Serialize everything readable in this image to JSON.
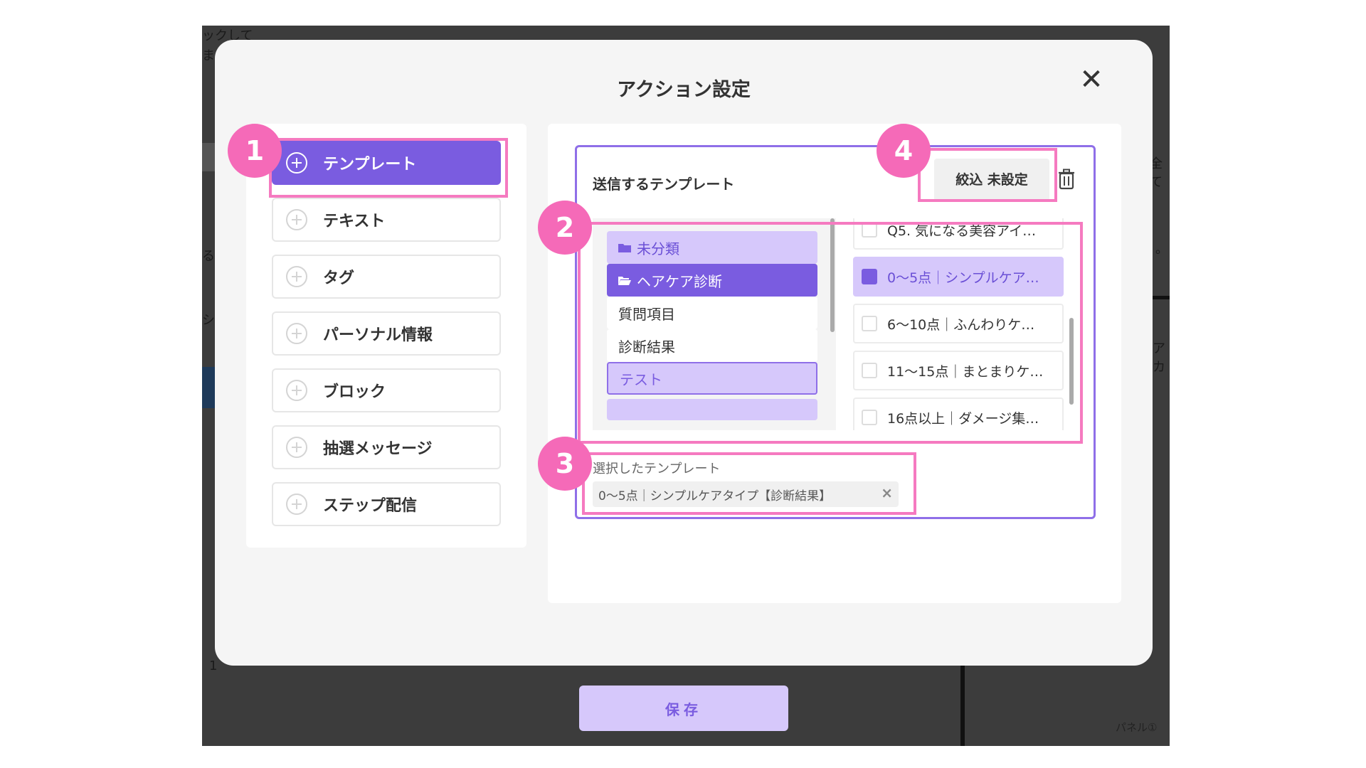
{
  "background": {
    "top_text_1": "ックして",
    "top_text_2": "ま",
    "left_frag_1": "る",
    "left_frag_2": "シ",
    "left_frag_3": "1",
    "right_frag_1": "全て",
    "right_frag_2": "。",
    "right_frag_3": "アカ",
    "save_label": "保存",
    "panel_label": "パネル①"
  },
  "modal": {
    "title": "アクション設定",
    "close_glyph": "✕"
  },
  "actions": [
    {
      "label": "テンプレート",
      "active": true
    },
    {
      "label": "テキスト"
    },
    {
      "label": "タグ"
    },
    {
      "label": "パーソナル情報"
    },
    {
      "label": "ブロック"
    },
    {
      "label": "抽選メッセージ"
    },
    {
      "label": "ステップ配信"
    }
  ],
  "template_box": {
    "title": "送信するテンプレート",
    "filter_label": "絞込 未設定",
    "folders": [
      {
        "label": "未分類",
        "style": "light",
        "icon": "folder-icon"
      },
      {
        "label": "ヘアケア診断",
        "style": "dark",
        "icon": "folder-open-icon"
      },
      {
        "label": "質問項目",
        "style": "white"
      },
      {
        "label": "診断結果",
        "style": "white"
      },
      {
        "label": "テスト",
        "style": "test"
      }
    ],
    "templates": [
      {
        "label": "Q5. 気になる美容アイ…",
        "selected": false
      },
      {
        "label": "0〜5点｜シンプルケア…",
        "selected": true
      },
      {
        "label": "6〜10点｜ふんわりケ…",
        "selected": false
      },
      {
        "label": "11〜15点｜まとまりケ…",
        "selected": false
      },
      {
        "label": "16点以上｜ダメージ集…",
        "selected": false
      }
    ],
    "selected_label": "選択したテンプレート",
    "selected_chip": "0〜5点｜シンプルケアタイプ【診断結果】",
    "chip_remove": "×"
  },
  "badges": [
    "1",
    "2",
    "3",
    "4"
  ],
  "colors": {
    "accent": "#7a5ce0",
    "accent_light": "#d6c8fb",
    "highlight": "#f57ac0"
  }
}
